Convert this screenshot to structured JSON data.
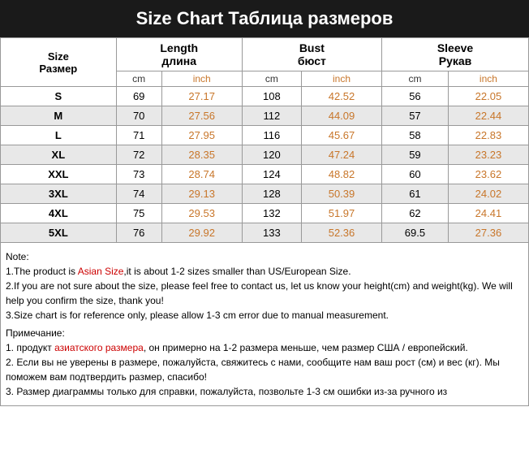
{
  "header": {
    "title": "Size Chart  Таблица размеров"
  },
  "table": {
    "columns": [
      {
        "main": "Size\nРазмер",
        "sub_cm": "",
        "sub_inch": ""
      },
      {
        "main": "Length\nдлина",
        "sub_cm": "cm",
        "sub_inch": "inch"
      },
      {
        "main": "Bust\nбюст",
        "sub_cm": "cm",
        "sub_inch": "inch"
      },
      {
        "main": "Sleeve\nРукав",
        "sub_cm": "cm",
        "sub_inch": "inch"
      }
    ],
    "rows": [
      {
        "size": "S",
        "len_cm": "69",
        "len_inch": "27.17",
        "bust_cm": "108",
        "bust_inch": "42.52",
        "sleeve_cm": "56",
        "sleeve_inch": "22.05"
      },
      {
        "size": "M",
        "len_cm": "70",
        "len_inch": "27.56",
        "bust_cm": "112",
        "bust_inch": "44.09",
        "sleeve_cm": "57",
        "sleeve_inch": "22.44"
      },
      {
        "size": "L",
        "len_cm": "71",
        "len_inch": "27.95",
        "bust_cm": "116",
        "bust_inch": "45.67",
        "sleeve_cm": "58",
        "sleeve_inch": "22.83"
      },
      {
        "size": "XL",
        "len_cm": "72",
        "len_inch": "28.35",
        "bust_cm": "120",
        "bust_inch": "47.24",
        "sleeve_cm": "59",
        "sleeve_inch": "23.23"
      },
      {
        "size": "XXL",
        "len_cm": "73",
        "len_inch": "28.74",
        "bust_cm": "124",
        "bust_inch": "48.82",
        "sleeve_cm": "60",
        "sleeve_inch": "23.62"
      },
      {
        "size": "3XL",
        "len_cm": "74",
        "len_inch": "29.13",
        "bust_cm": "128",
        "bust_inch": "50.39",
        "sleeve_cm": "61",
        "sleeve_inch": "24.02"
      },
      {
        "size": "4XL",
        "len_cm": "75",
        "len_inch": "29.53",
        "bust_cm": "132",
        "bust_inch": "51.97",
        "sleeve_cm": "62",
        "sleeve_inch": "24.41"
      },
      {
        "size": "5XL",
        "len_cm": "76",
        "len_inch": "29.92",
        "bust_cm": "133",
        "bust_inch": "52.36",
        "sleeve_cm": "69.5",
        "sleeve_inch": "27.36"
      }
    ]
  },
  "notes": {
    "title_en": "Note:",
    "line1_before": "1.The product is ",
    "line1_red": "Asian Size",
    "line1_after": ",it is about 1-2 sizes smaller than US/European Size.",
    "line2": "2.If you are not sure about the size, please feel free to contact us, let us know your height(cm) and weight(kg). We will help you confirm the size, thank you!",
    "line3": "3.Size chart is for reference only, please allow 1-3 cm error due to manual measurement.",
    "title_ru": "Примечание:",
    "ru_line1_before": "1. продукт ",
    "ru_line1_red": "азиатского размера",
    "ru_line1_after": ", он примерно на 1-2 размера меньше, чем размер США / европейский.",
    "ru_line2": "2. Если вы не уверены в размере, пожалуйста, свяжитесь с нами, сообщите нам ваш рост (см) и вес (кг). Мы поможем вам подтвердить размер, спасибо!",
    "ru_line3": "3. Размер диаграммы только для справки, пожалуйста, позвольте 1-3 см ошибки из-за ручного из"
  }
}
